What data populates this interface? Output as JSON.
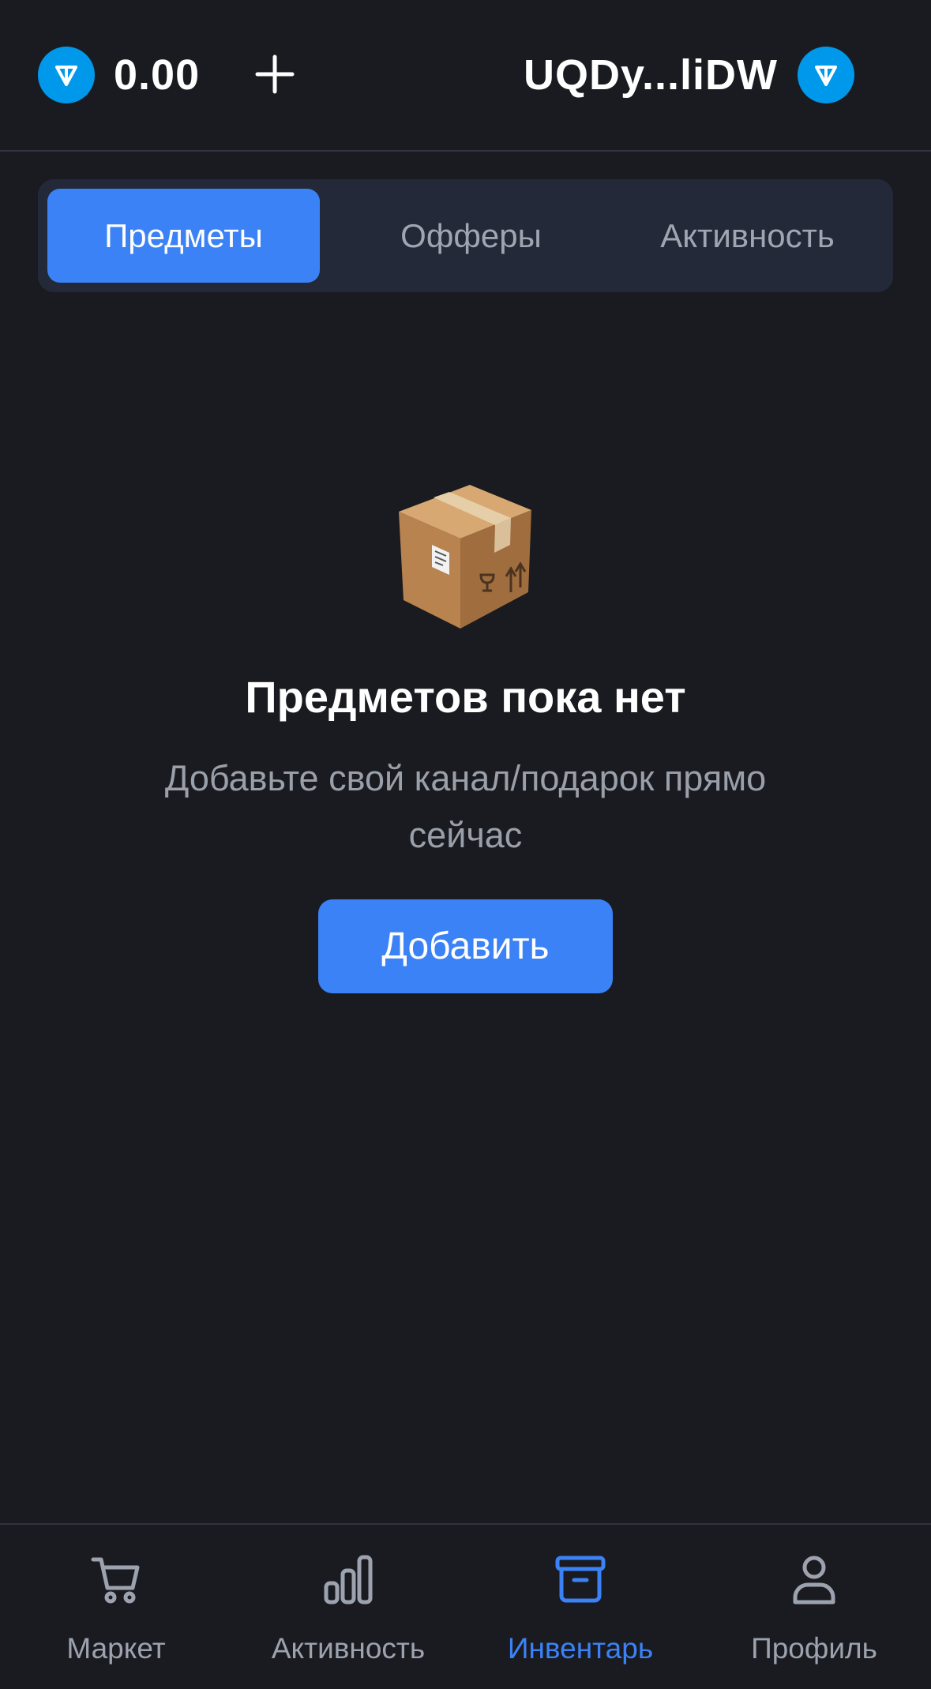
{
  "header": {
    "balance": "0.00",
    "balance_currency_icon": "ton-icon",
    "add_funds_icon": "plus-icon",
    "wallet_address": "UQDy...liDW",
    "wallet_icon": "ton-icon"
  },
  "tabs": [
    {
      "label": "Предметы",
      "active": true
    },
    {
      "label": "Офферы",
      "active": false
    },
    {
      "label": "Активность",
      "active": false
    }
  ],
  "empty_state": {
    "icon": "package-box-icon",
    "title": "Предметов пока нет",
    "subtitle": "Добавьте свой канал/подарок прямо сейчас",
    "button_label": "Добавить"
  },
  "bottom_nav": [
    {
      "label": "Маркет",
      "icon": "cart-icon",
      "active": false
    },
    {
      "label": "Активность",
      "icon": "bar-chart-icon",
      "active": false
    },
    {
      "label": "Инвентарь",
      "icon": "archive-box-icon",
      "active": true
    },
    {
      "label": "Профиль",
      "icon": "user-icon",
      "active": false
    }
  ],
  "colors": {
    "background": "#1a1b20",
    "accent": "#3b82f6",
    "ton_blue": "#0098ea",
    "tab_bar_bg": "#232939",
    "muted_text": "#9ca3af"
  }
}
